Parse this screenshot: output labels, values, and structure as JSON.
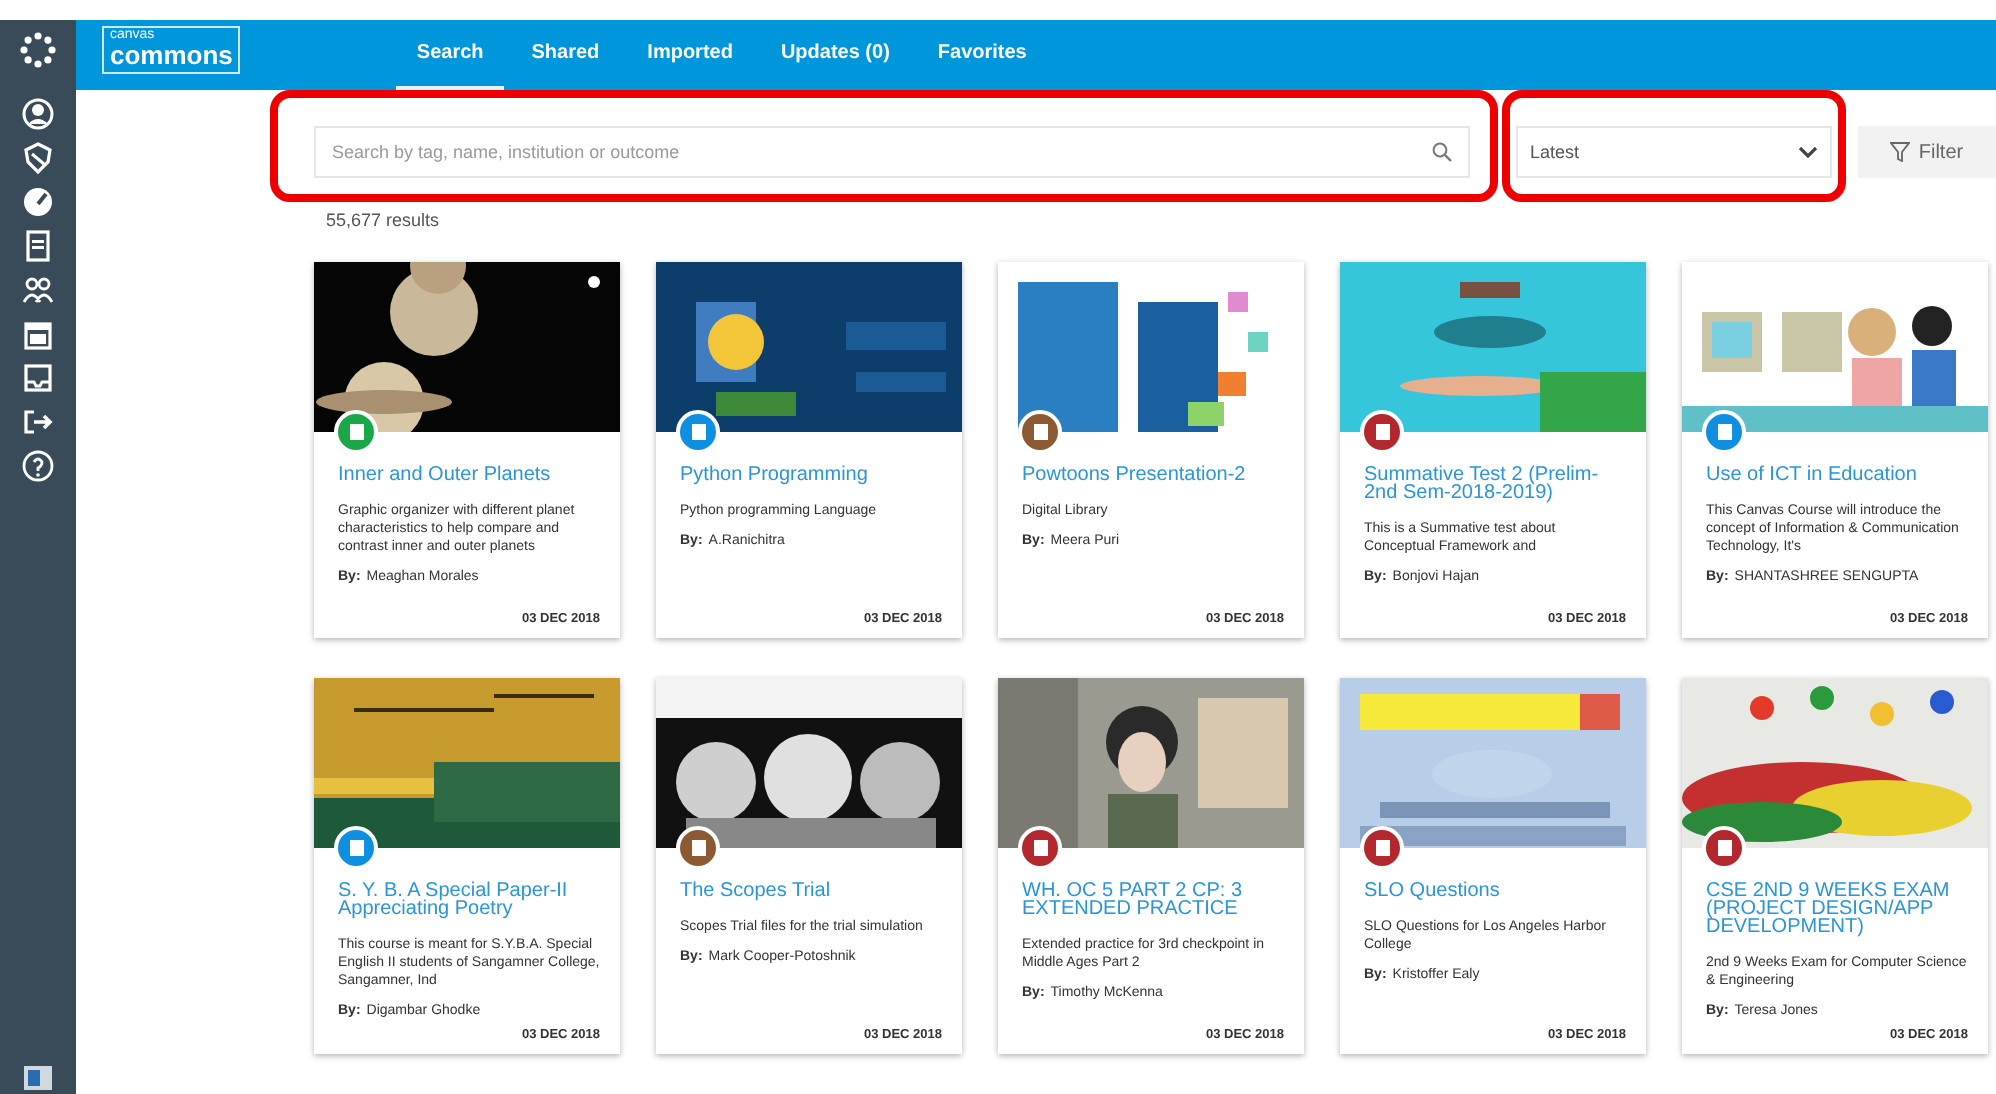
{
  "logo": {
    "small": "canvas",
    "main": "commons"
  },
  "tabs": [
    {
      "label": "Search",
      "selected": true
    },
    {
      "label": "Shared",
      "selected": false
    },
    {
      "label": "Imported",
      "selected": false
    },
    {
      "label": "Updates (0)",
      "selected": false
    },
    {
      "label": "Favorites",
      "selected": false
    }
  ],
  "search": {
    "placeholder": "Search by tag, name, institution or outcome"
  },
  "sort": {
    "value": "Latest"
  },
  "filter_button": "Filter",
  "results": "55,677 results",
  "cards": [
    {
      "title": "Inner and Outer Planets",
      "description": "Graphic organizer with different planet characteristics to help compare and contrast inner and outer planets",
      "by": "By:",
      "author": "Meaghan Morales",
      "date": "03 DEC 2018",
      "color": "#1aa748"
    },
    {
      "title": "Python Programming",
      "description": "Python programming Language",
      "by": "By:",
      "author": "A.Ranichitra",
      "date": "03 DEC 2018",
      "color": "#0e8fe0"
    },
    {
      "title": "Powtoons Presentation-2",
      "description": "Digital Library",
      "by": "By:",
      "author": "Meera Puri",
      "date": "03 DEC 2018",
      "color": "#8b5a32"
    },
    {
      "title": "Summative Test 2 (Prelim-2nd Sem-2018-2019)",
      "description": "This is a Summative test about Conceptual Framework and",
      "by": "By:",
      "author": "Bonjovi Hajan",
      "date": "03 DEC 2018",
      "color": "#b2282e"
    },
    {
      "title": "Use of ICT in Education",
      "description": "This Canvas Course will introduce the concept of Information & Communication Technology, It's",
      "by": "By:",
      "author": "SHANTASHREE SENGUPTA",
      "date": "03 DEC 2018",
      "color": "#0e8fe0"
    },
    {
      "title": "S. Y. B. A Special Paper-II Appreciating Poetry",
      "description": "This course is meant for S.Y.B.A. Special English II students of Sangamner College, Sangamner, Ind",
      "by": "By:",
      "author": "Digambar Ghodke",
      "date": "03 DEC 2018",
      "color": "#0e8fe0"
    },
    {
      "title": "The Scopes Trial",
      "description": "Scopes Trial files for the trial simulation",
      "by": "By:",
      "author": "Mark Cooper-Potoshnik",
      "date": "03 DEC 2018",
      "color": "#8b5a32"
    },
    {
      "title": "WH. OC 5 PART 2 CP: 3 EXTENDED PRACTICE",
      "description": "Extended practice for 3rd checkpoint in Middle Ages Part 2",
      "by": "By:",
      "author": "Timothy McKenna",
      "date": "03 DEC 2018",
      "color": "#b2282e"
    },
    {
      "title": "SLO Questions",
      "description": "SLO Questions for Los Angeles Harbor College",
      "by": "By:",
      "author": "Kristoffer Ealy",
      "date": "03 DEC 2018",
      "color": "#b2282e"
    },
    {
      "title": "CSE 2ND 9 WEEKS EXAM (PROJECT DESIGN/APP DEVELOPMENT)",
      "description": "2nd 9 Weeks Exam for Computer Science & Engineering",
      "by": "By:",
      "author": "Teresa Jones",
      "date": "03 DEC 2018",
      "color": "#b2282e"
    }
  ]
}
